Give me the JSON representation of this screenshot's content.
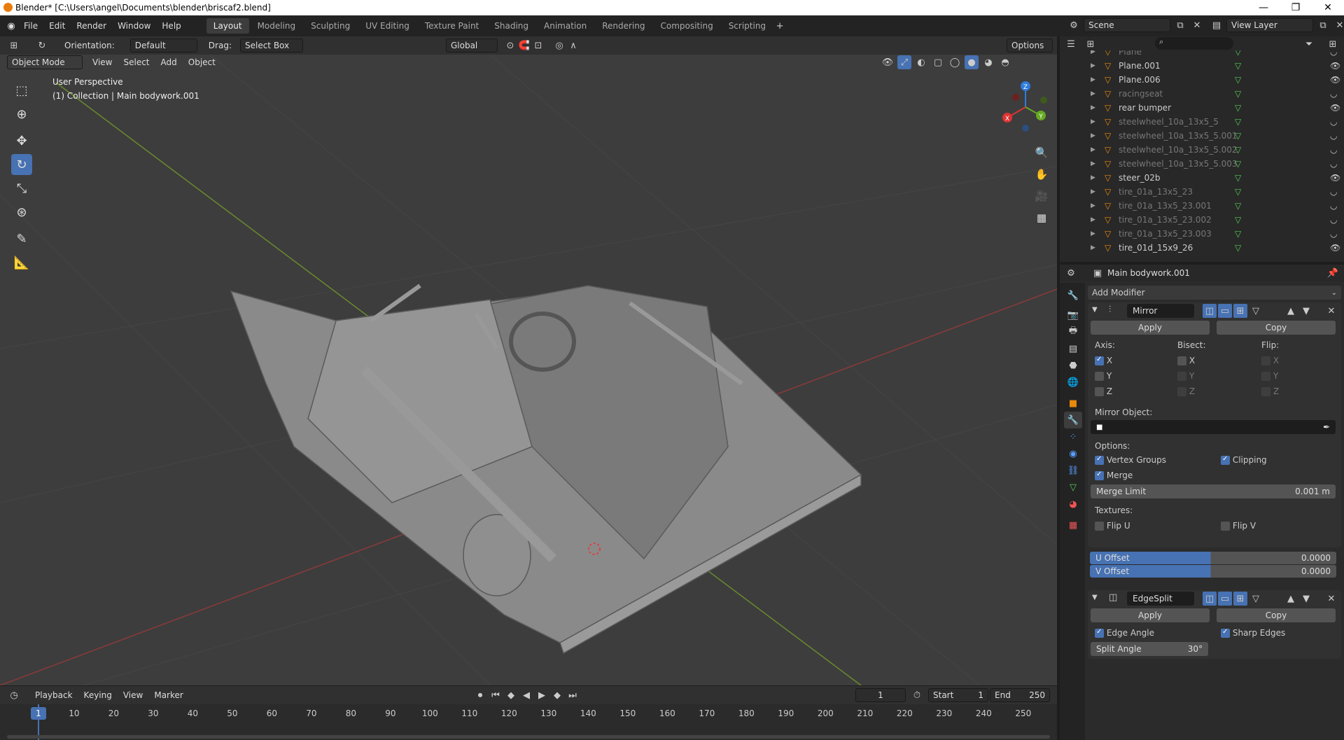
{
  "title": "Blender* [C:\\Users\\angel\\Documents\\blender\\briscaf2.blend]",
  "menus": [
    "File",
    "Edit",
    "Render",
    "Window",
    "Help"
  ],
  "workspaces": [
    "Layout",
    "Modeling",
    "Sculpting",
    "UV Editing",
    "Texture Paint",
    "Shading",
    "Animation",
    "Rendering",
    "Compositing",
    "Scripting"
  ],
  "header": {
    "orientation_label": "Orientation:",
    "orientation_value": "Default",
    "drag_label": "Drag:",
    "drag_value": "Select Box",
    "transform": "Global",
    "options": "Options"
  },
  "scene": {
    "scene_name": "Scene",
    "view_layer": "View Layer"
  },
  "viewport": {
    "mode": "Object Mode",
    "menus": [
      "View",
      "Select",
      "Add",
      "Object"
    ],
    "perspective": "User Perspective",
    "collection_info": "(1) Collection | Main bodywork.001",
    "axes": {
      "x": "X",
      "y": "Y",
      "z": "Z"
    }
  },
  "outliner": {
    "items": [
      {
        "name": "Plane",
        "dim": true
      },
      {
        "name": "Plane.001",
        "dim": false
      },
      {
        "name": "Plane.006",
        "dim": false
      },
      {
        "name": "racingseat",
        "dim": true
      },
      {
        "name": "rear bumper",
        "dim": false
      },
      {
        "name": "steelwheel_10a_13x5_5",
        "dim": true
      },
      {
        "name": "steelwheel_10a_13x5_5.001",
        "dim": true
      },
      {
        "name": "steelwheel_10a_13x5_5.002",
        "dim": true
      },
      {
        "name": "steelwheel_10a_13x5_5.003",
        "dim": true
      },
      {
        "name": "steer_02b",
        "dim": false
      },
      {
        "name": "tire_01a_13x5_23",
        "dim": true
      },
      {
        "name": "tire_01a_13x5_23.001",
        "dim": true
      },
      {
        "name": "tire_01a_13x5_23.002",
        "dim": true
      },
      {
        "name": "tire_01a_13x5_23.003",
        "dim": true
      },
      {
        "name": "tire_01d_15x9_26",
        "dim": false
      }
    ]
  },
  "properties": {
    "object_name": "Main bodywork.001",
    "add_modifier": "Add Modifier",
    "mirror": {
      "name": "Mirror",
      "apply": "Apply",
      "copy": "Copy",
      "axis_label": "Axis:",
      "bisect_label": "Bisect:",
      "flip_label": "Flip:",
      "x": "X",
      "y": "Y",
      "z": "Z",
      "mirror_object_label": "Mirror Object:",
      "options_label": "Options:",
      "vertex_groups": "Vertex Groups",
      "clipping": "Clipping",
      "merge": "Merge",
      "merge_limit_label": "Merge Limit",
      "merge_limit_value": "0.001 m",
      "textures_label": "Textures:",
      "flip_u": "Flip U",
      "flip_v": "Flip V",
      "u_offset_label": "U Offset",
      "u_offset_value": "0.0000",
      "v_offset_label": "V Offset",
      "v_offset_value": "0.0000"
    },
    "edgesplit": {
      "name": "EdgeSplit",
      "apply": "Apply",
      "copy": "Copy",
      "edge_angle": "Edge Angle",
      "sharp_edges": "Sharp Edges",
      "split_angle_label": "Split Angle",
      "split_angle_value": "30°"
    }
  },
  "timeline": {
    "menus": [
      "Playback",
      "Keying",
      "View",
      "Marker"
    ],
    "current_frame": "1",
    "start_label": "Start",
    "start": "1",
    "end_label": "End",
    "end": "250",
    "ticks": [
      "1",
      "10",
      "20",
      "30",
      "40",
      "50",
      "60",
      "70",
      "80",
      "90",
      "100",
      "110",
      "120",
      "130",
      "140",
      "150",
      "160",
      "170",
      "180",
      "190",
      "200",
      "210",
      "220",
      "230",
      "240",
      "250"
    ]
  }
}
